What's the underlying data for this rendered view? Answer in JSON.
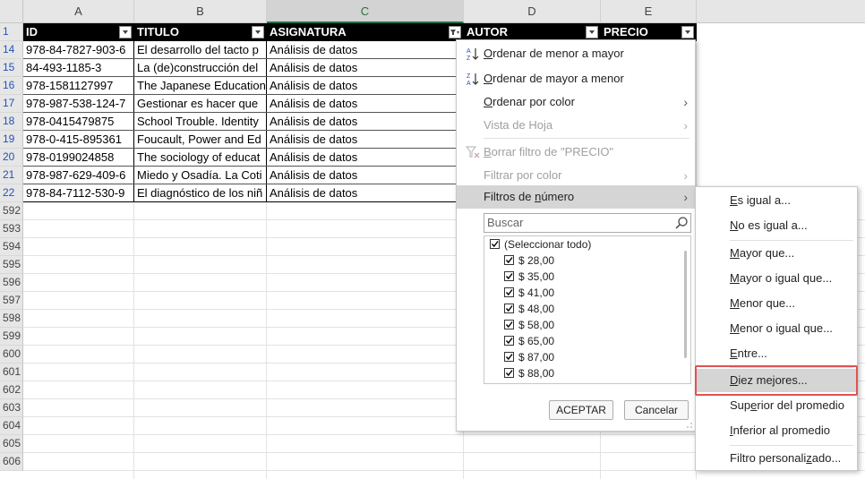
{
  "columns": [
    {
      "letter": "A",
      "header": "ID"
    },
    {
      "letter": "B",
      "header": "TITULO"
    },
    {
      "letter": "C",
      "header": "ASIGNATURA"
    },
    {
      "letter": "D",
      "header": "AUTOR"
    },
    {
      "letter": "E",
      "header": "PRECIO"
    }
  ],
  "header_row_number": "1",
  "rows": [
    {
      "num": "14",
      "id": "978-84-7827-903-6",
      "titulo": "El desarrollo del tacto p",
      "asignatura": "Análisis de datos"
    },
    {
      "num": "15",
      "id": "84-493-1185-3",
      "titulo": "La (de)construcción del",
      "asignatura": "Análisis de datos"
    },
    {
      "num": "16",
      "id": "978-1581127997",
      "titulo": "The Japanese Education",
      "asignatura": "Análisis de datos"
    },
    {
      "num": "17",
      "id": "978-987-538-124-7",
      "titulo": "Gestionar es hacer que",
      "asignatura": "Análisis de datos"
    },
    {
      "num": "18",
      "id": "978-0415479875",
      "titulo": "School Trouble. Identity",
      "asignatura": "Análisis de datos"
    },
    {
      "num": "19",
      "id": "978-0-415-895361",
      "titulo": "Foucault, Power and Ed",
      "asignatura": "Análisis de datos"
    },
    {
      "num": "20",
      "id": "978-0199024858",
      "titulo": "The sociology of educat",
      "asignatura": "Análisis de datos"
    },
    {
      "num": "21",
      "id": "978-987-629-409-6",
      "titulo": "Miedo y Osadía. La Coti",
      "asignatura": "Análisis de datos"
    },
    {
      "num": "22",
      "id": "978-84-7112-530-9",
      "titulo": "El diagnóstico de los niñ",
      "asignatura": "Análisis de datos"
    }
  ],
  "empty_rows": [
    "592",
    "593",
    "594",
    "595",
    "596",
    "597",
    "598",
    "599",
    "600",
    "601",
    "602",
    "603",
    "604",
    "605",
    "606"
  ],
  "filter_menu": {
    "sort_asc": {
      "u": "O",
      "rest": "rdenar de menor a mayor"
    },
    "sort_desc": {
      "u": "O",
      "rest": "rdenar de mayor a menor"
    },
    "sort_color": {
      "u": "O",
      "rest": "rdenar por color"
    },
    "sheet_view": "Vista de Hoja",
    "clear_filter": {
      "u": "B",
      "rest": "orrar filtro de \"PRECIO\""
    },
    "filter_color": "Filtrar por color",
    "number_filters": {
      "pre": "Filtros de ",
      "u": "n",
      "rest": "úmero"
    },
    "search_placeholder": "Buscar",
    "values": [
      "(Seleccionar todo)",
      "$ 28,00",
      "$ 35,00",
      "$ 41,00",
      "$ 48,00",
      "$ 58,00",
      "$ 65,00",
      "$ 87,00",
      "$ 88,00"
    ],
    "accept": "ACEPTAR",
    "cancel": "Cancelar"
  },
  "number_submenu": [
    {
      "u": "E",
      "rest": "s igual a..."
    },
    {
      "u": "N",
      "rest": "o es igual a..."
    },
    {
      "u": "M",
      "rest": "ayor que..."
    },
    {
      "u": "M",
      "rest": "ayor o igual que..."
    },
    {
      "u": "M",
      "rest": "enor que..."
    },
    {
      "u": "M",
      "rest": "enor o igual que..."
    },
    {
      "u": "E",
      "rest": "ntre..."
    },
    {
      "u": "D",
      "rest": "iez mejores..."
    },
    {
      "pre": "Sup",
      "u": "e",
      "rest": "rior del promedio"
    },
    {
      "u": "I",
      "rest": "nferior al promedio"
    },
    {
      "pre": "Filtro personali",
      "u": "z",
      "rest": "ado..."
    }
  ],
  "colors": {
    "accent_green": "#217346",
    "row_num_blue": "#2453b6",
    "highlight_red": "#e05252"
  }
}
